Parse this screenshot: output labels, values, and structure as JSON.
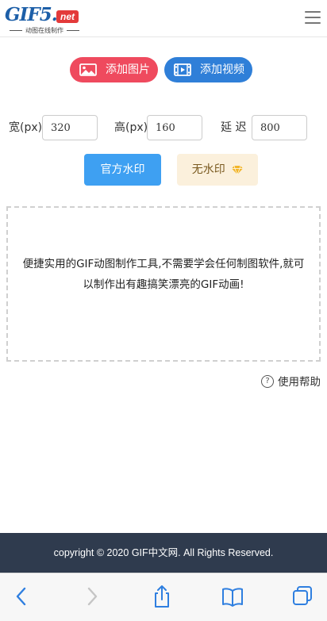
{
  "header": {
    "logo_main": "GIF5.",
    "logo_badge": "net",
    "logo_sub": "动图在线制作",
    "menu_icon": "hamburger-menu-icon"
  },
  "upload": {
    "add_image_label": "添加图片",
    "add_video_label": "添加视频"
  },
  "dimensions": {
    "width_label": "宽(px)",
    "width_value": "320",
    "height_label": "高(px)",
    "height_value": "160",
    "delay_label": "延 迟",
    "delay_value": "800"
  },
  "watermark": {
    "official_label": "官方水印",
    "none_label": "无水印"
  },
  "dropzone": {
    "text": "便捷实用的GIF动图制作工具,不需要学会任何制图软件,就可以制作出有趣搞笑漂亮的GIF动画!"
  },
  "help": {
    "label": "使用帮助"
  },
  "footer": {
    "copyright": "copyright © 2020 GIF中文网. All Rights Reserved."
  },
  "colors": {
    "add_image_button": "#ef4a5e",
    "add_video_button": "#2f7fd8",
    "official_watermark_button": "#3ea0f2",
    "no_watermark_button": "#fbf0dc",
    "footer_background": "#2f3b4e",
    "logo_blue": "#1d5fa8",
    "logo_badge_red": "#e33a3a"
  },
  "toolbar_icons": [
    "back-chevron-icon",
    "forward-chevron-icon",
    "share-icon",
    "bookmarks-icon",
    "tabs-icon"
  ]
}
